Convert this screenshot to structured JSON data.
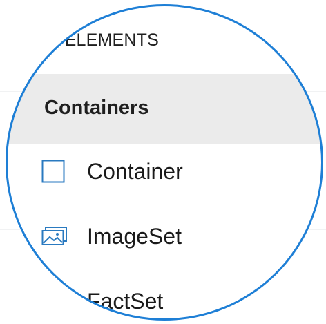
{
  "toolbox": {
    "section_label": "RD ELEMENTS",
    "group": {
      "title": "Containers"
    },
    "items": [
      {
        "label": "Container",
        "icon": "container-square-icon"
      },
      {
        "label": "ImageSet",
        "icon": "imageset-icon"
      },
      {
        "label": "FactSet",
        "icon": "factset-icon"
      }
    ]
  },
  "colors": {
    "lens_ring": "#1e7fd6",
    "icon_blue": "#2a7ac0",
    "group_header_bg": "#ebebeb"
  }
}
